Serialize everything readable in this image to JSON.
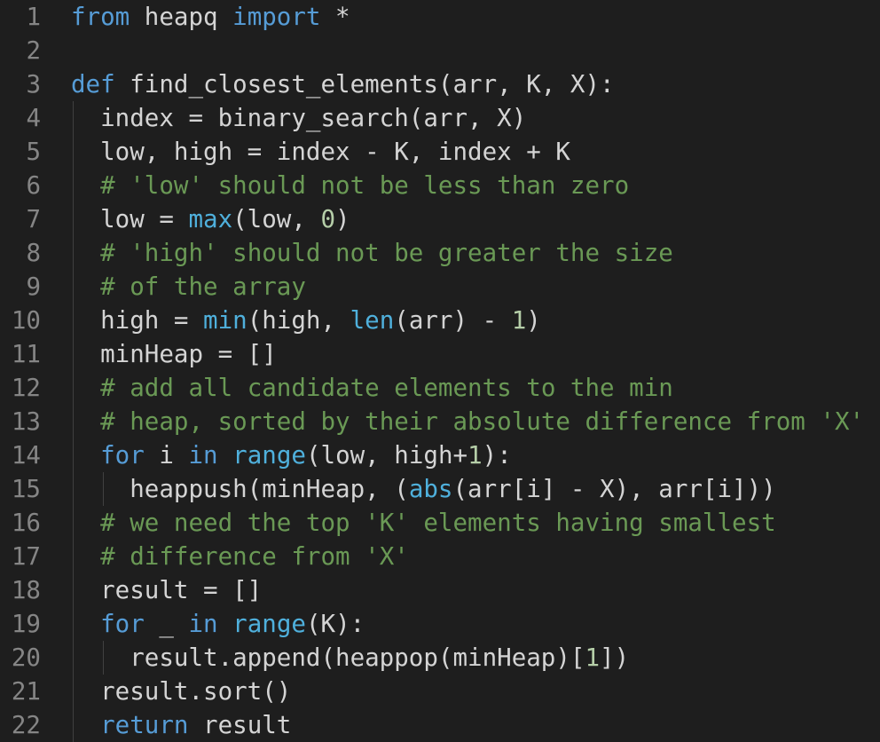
{
  "theme": {
    "background": "#1e1e1e",
    "foreground": "#d4d4d4",
    "line_number": "#858585",
    "keyword": "#569cd6",
    "builtin": "#4fb0dc",
    "comment": "#6a9955",
    "number": "#b5cea8",
    "indent_guide": "#404040"
  },
  "lines": [
    {
      "n": "1",
      "tokens": [
        {
          "t": "from",
          "c": "kw"
        },
        {
          "t": " heapq ",
          "c": "tx"
        },
        {
          "t": "import",
          "c": "kw"
        },
        {
          "t": " *",
          "c": "tx"
        }
      ]
    },
    {
      "n": "2",
      "tokens": []
    },
    {
      "n": "3",
      "tokens": [
        {
          "t": "def",
          "c": "kw"
        },
        {
          "t": " find_closest_elements(arr, K, X):",
          "c": "tx"
        }
      ]
    },
    {
      "n": "4",
      "tokens": [
        {
          "t": "  index = binary_search(arr, X)",
          "c": "tx"
        }
      ]
    },
    {
      "n": "5",
      "tokens": [
        {
          "t": "  low, high = index - K, index + K",
          "c": "tx"
        }
      ]
    },
    {
      "n": "6",
      "tokens": [
        {
          "t": "  ",
          "c": "tx"
        },
        {
          "t": "# 'low' should not be less than zero",
          "c": "cm"
        }
      ]
    },
    {
      "n": "7",
      "tokens": [
        {
          "t": "  low = ",
          "c": "tx"
        },
        {
          "t": "max",
          "c": "bi"
        },
        {
          "t": "(low, ",
          "c": "tx"
        },
        {
          "t": "0",
          "c": "nm"
        },
        {
          "t": ")",
          "c": "tx"
        }
      ]
    },
    {
      "n": "8",
      "tokens": [
        {
          "t": "  ",
          "c": "tx"
        },
        {
          "t": "# 'high' should not be greater the size",
          "c": "cm"
        }
      ]
    },
    {
      "n": "9",
      "tokens": [
        {
          "t": "  ",
          "c": "tx"
        },
        {
          "t": "# of the array",
          "c": "cm"
        }
      ]
    },
    {
      "n": "10",
      "tokens": [
        {
          "t": "  high = ",
          "c": "tx"
        },
        {
          "t": "min",
          "c": "bi"
        },
        {
          "t": "(high, ",
          "c": "tx"
        },
        {
          "t": "len",
          "c": "bi"
        },
        {
          "t": "(arr) - ",
          "c": "tx"
        },
        {
          "t": "1",
          "c": "nm"
        },
        {
          "t": ")",
          "c": "tx"
        }
      ]
    },
    {
      "n": "11",
      "tokens": [
        {
          "t": "  minHeap = []",
          "c": "tx"
        }
      ]
    },
    {
      "n": "12",
      "tokens": [
        {
          "t": "  ",
          "c": "tx"
        },
        {
          "t": "# add all candidate elements to the min",
          "c": "cm"
        }
      ]
    },
    {
      "n": "13",
      "tokens": [
        {
          "t": "  ",
          "c": "tx"
        },
        {
          "t": "# heap, sorted by their absolute difference from 'X'",
          "c": "cm"
        }
      ]
    },
    {
      "n": "14",
      "tokens": [
        {
          "t": "  ",
          "c": "tx"
        },
        {
          "t": "for",
          "c": "kw"
        },
        {
          "t": " i ",
          "c": "tx"
        },
        {
          "t": "in",
          "c": "kw"
        },
        {
          "t": " ",
          "c": "tx"
        },
        {
          "t": "range",
          "c": "bi"
        },
        {
          "t": "(low, high+",
          "c": "tx"
        },
        {
          "t": "1",
          "c": "nm"
        },
        {
          "t": "):",
          "c": "tx"
        }
      ]
    },
    {
      "n": "15",
      "tokens": [
        {
          "t": "    heappush(minHeap, (",
          "c": "tx"
        },
        {
          "t": "abs",
          "c": "bi"
        },
        {
          "t": "(arr[i] - X), arr[i]))",
          "c": "tx"
        }
      ]
    },
    {
      "n": "16",
      "tokens": [
        {
          "t": "  ",
          "c": "tx"
        },
        {
          "t": "# we need the top 'K' elements having smallest",
          "c": "cm"
        }
      ]
    },
    {
      "n": "17",
      "tokens": [
        {
          "t": "  ",
          "c": "tx"
        },
        {
          "t": "# difference from 'X'",
          "c": "cm"
        }
      ]
    },
    {
      "n": "18",
      "tokens": [
        {
          "t": "  result = []",
          "c": "tx"
        }
      ]
    },
    {
      "n": "19",
      "tokens": [
        {
          "t": "  ",
          "c": "tx"
        },
        {
          "t": "for",
          "c": "kw"
        },
        {
          "t": " _ ",
          "c": "tx"
        },
        {
          "t": "in",
          "c": "kw"
        },
        {
          "t": " ",
          "c": "tx"
        },
        {
          "t": "range",
          "c": "bi"
        },
        {
          "t": "(K):",
          "c": "tx"
        }
      ]
    },
    {
      "n": "20",
      "tokens": [
        {
          "t": "    result.append(heappop(minHeap)[",
          "c": "tx"
        },
        {
          "t": "1",
          "c": "nm"
        },
        {
          "t": "])",
          "c": "tx"
        }
      ]
    },
    {
      "n": "21",
      "tokens": [
        {
          "t": "  result.sort()",
          "c": "tx"
        }
      ]
    },
    {
      "n": "22",
      "tokens": [
        {
          "t": "  ",
          "c": "tx"
        },
        {
          "t": "return",
          "c": "kw"
        },
        {
          "t": " result",
          "c": "tx"
        }
      ]
    }
  ]
}
